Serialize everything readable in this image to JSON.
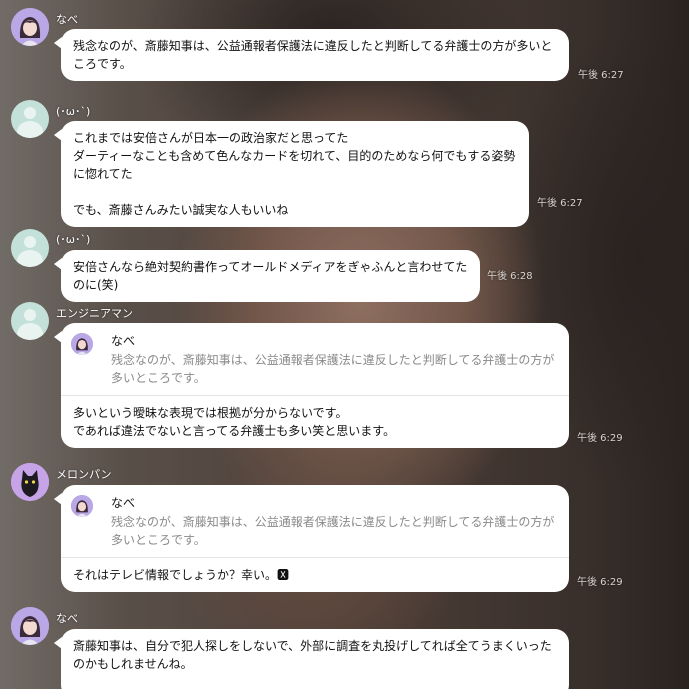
{
  "messages": [
    {
      "sender": "なべ",
      "avatar": "nabe-avatar",
      "text": "残念なのが、斎藤知事は、公益通報者保護法に違反したと判断してる弁護士の方が多いところです。",
      "time": "午後 6:27"
    },
    {
      "sender": "(･ω･`)",
      "avatar": "default-avatar",
      "text": "これまでは安倍さんが日本一の政治家だと思ってた\nダーティーなことも含めて色んなカードを切れて、目的のためなら何でもする姿勢に惚れてた\n\nでも、斎藤さんみたい誠実な人もいいね",
      "time": "午後 6:27"
    },
    {
      "sender": "(･ω･`)",
      "avatar": "default-avatar",
      "text": "安倍さんなら絶対契約書作ってオールドメディアをぎゃふんと言わせてたのに(笑)",
      "time": "午後 6:28"
    },
    {
      "sender": "エンジニアマン",
      "avatar": "default-avatar",
      "quote": {
        "name": "なべ",
        "text": "残念なのが、斎藤知事は、公益通報者保護法に違反したと判断してる弁護士の方が多いところです。"
      },
      "text": "多いという曖昧な表現では根拠が分からないです。\nであれば違法でないと言ってる弁護士も多い笑と思います。",
      "time": "午後 6:29"
    },
    {
      "sender": "メロンパン",
      "avatar": "cat-avatar",
      "quote": {
        "name": "なべ",
        "text": "残念なのが、斎藤知事は、公益通報者保護法に違反したと判断してる弁護士の方が多いところです。"
      },
      "text": "それはテレビ情報でしょうか？幸い。🆇",
      "time": "午後 6:29"
    },
    {
      "sender": "なべ",
      "avatar": "nabe-avatar",
      "text": "斎藤知事は、自分で犯人探しをしないで、外部に調査を丸投げしてれば全てうまくいったのかもしれませんね。",
      "time": ""
    }
  ]
}
